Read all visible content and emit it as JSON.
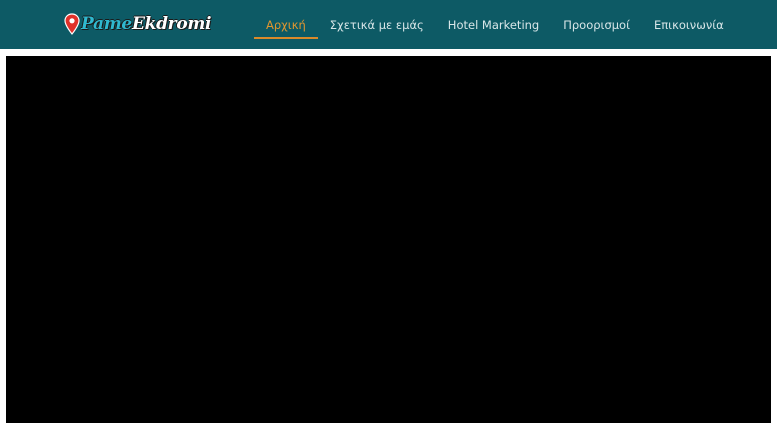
{
  "logo": {
    "part1": "Pame",
    "part2": "Ekdromi",
    "icon": "map-pin-icon",
    "pin_color": "#e0312a"
  },
  "nav": {
    "items": [
      {
        "label": "Αρχική",
        "active": true
      },
      {
        "label": "Σχετικά με εμάς",
        "active": false
      },
      {
        "label": "Hotel Marketing",
        "active": false
      },
      {
        "label": "Προορισμοί",
        "active": false
      },
      {
        "label": "Επικοινωνία",
        "active": false
      }
    ]
  },
  "colors": {
    "header_bg": "#0d5a65",
    "active_accent": "#e0962f",
    "nav_text": "#d8e6e8",
    "content_bg": "#000000"
  }
}
